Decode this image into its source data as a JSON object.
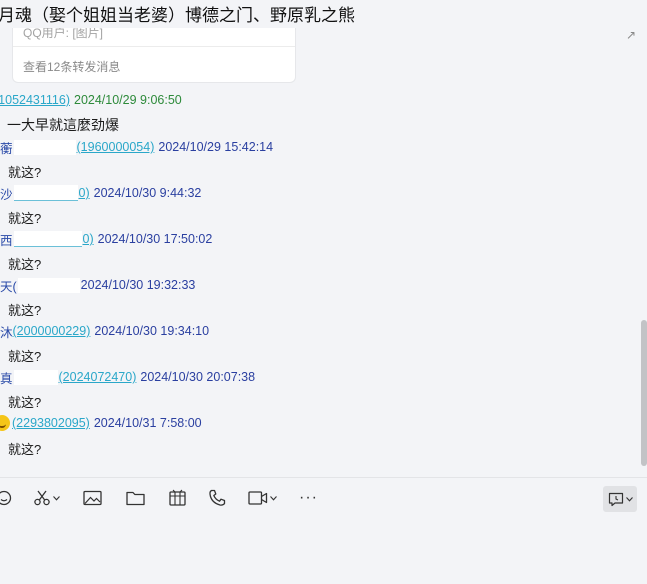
{
  "window": {
    "title": "月魂（娶个姐姐当老婆）博德之门、野原乳之熊"
  },
  "forward_card": {
    "preview": "QQ用户: [图片]",
    "view_link": "查看12条转发消息"
  },
  "messages": [
    {
      "qq_id": "(1052431116)",
      "time": "2024/10/29 9:06:50",
      "text": "一大早就這麼劲爆"
    },
    {
      "sender_prefix": "蘅",
      "qq_id": "(1960000054)",
      "time": "2024/10/29 15:42:14",
      "text": "就这?"
    },
    {
      "sender_prefix": "沙",
      "qq_id": "0)",
      "time": "2024/10/30 9:44:32",
      "text": "就这?"
    },
    {
      "sender_prefix": "西",
      "qq_id": "0)",
      "time": "2024/10/30 17:50:02",
      "text": "就这?"
    },
    {
      "sender_prefix": "天(",
      "qq_id": "",
      "time": "2024/10/30 19:32:33",
      "text": "就这?"
    },
    {
      "sender_prefix": "沐",
      "qq_id": "(2000000229)",
      "time": "2024/10/30 19:34:10",
      "text": "就这?"
    },
    {
      "sender_prefix": "真",
      "qq_id": "(2024072470)",
      "time": "2024/10/30 20:07:38",
      "text": "就这?"
    },
    {
      "sender_prefix": "",
      "qq_id": "(2293802095)",
      "time": "2024/10/31 7:58:00",
      "text": "就这?"
    }
  ],
  "scrollbar": {
    "position": 0.82
  },
  "toolbar": {
    "tools": [
      "emoji-icon",
      "scissors-icon",
      "image-icon",
      "folder-icon",
      "red-packet-icon",
      "phone-icon",
      "video-icon",
      "more-icon"
    ],
    "more_label": "···"
  },
  "colors": {
    "background": "#f3f4f7",
    "sender_blue": "#2a4aa8",
    "time_blue": "#2a3fa0",
    "sender_green": "#3a9a45",
    "qq_id": "#2aa7c9"
  }
}
